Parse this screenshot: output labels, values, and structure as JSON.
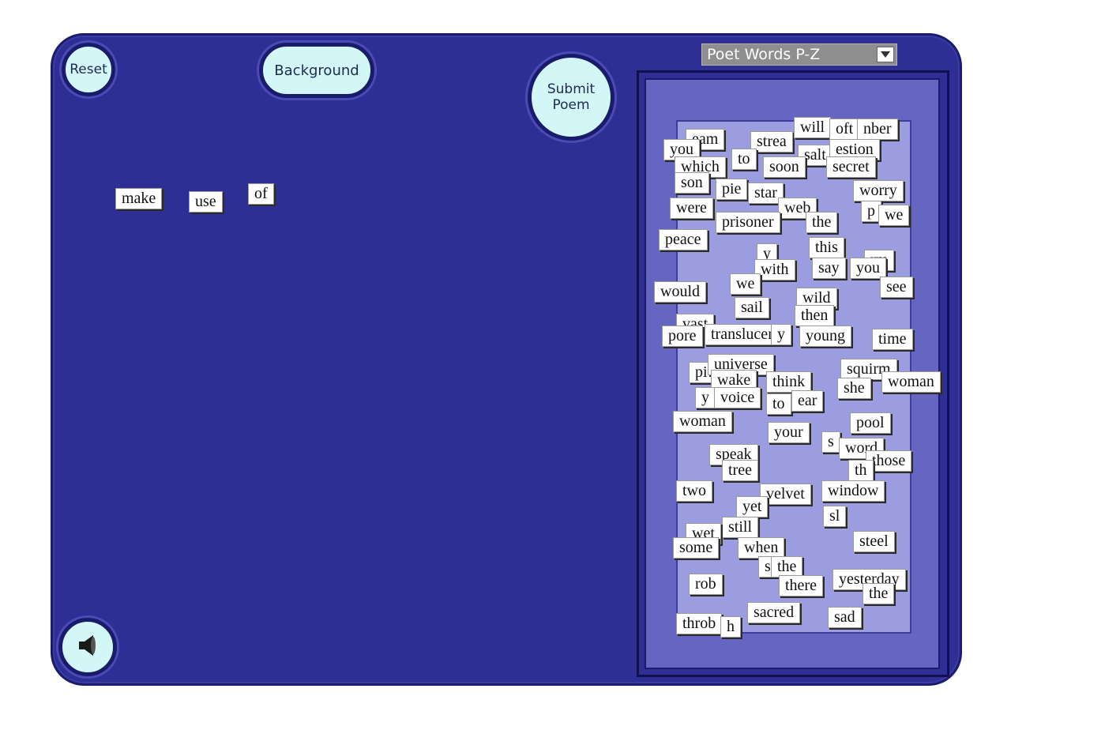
{
  "toolbar": {
    "reset_label": "Reset",
    "background_label": "Background",
    "submit_label": "Submit\nPoem",
    "speaker_icon": "speaker-icon"
  },
  "word_set_select": {
    "selected": "Poet Words P-Z",
    "arrow_icon": "chevron-down-icon"
  },
  "colors": {
    "board": "#2e2e94",
    "drawer_floor": "#9c9ce0",
    "button_fill": "#d3f7f7",
    "tile": "#ffffff"
  },
  "poem_words": [
    "make",
    "use",
    "of"
  ],
  "drawer_words": [
    "eam",
    "strea",
    "will",
    "oft",
    "nber",
    "you",
    "to",
    "salt",
    "estion",
    "which",
    "soon",
    "secret",
    "son",
    "pie",
    "star",
    "worry",
    "were",
    "web",
    "p",
    "we",
    "prisoner",
    "the",
    "peace",
    "this",
    "y",
    "rm",
    "say",
    "you",
    "with",
    "would",
    "we",
    "see",
    "sail",
    "wild",
    "then",
    "vast",
    "pore",
    "translucent",
    "y",
    "young",
    "time",
    "pi",
    "universe",
    "squirm",
    "woman",
    "she",
    "wake",
    "think",
    "y",
    "voice",
    "to",
    "ear",
    "woman",
    "pool",
    "your",
    "s",
    "word",
    "those",
    "speak",
    "th",
    "tree",
    "two",
    "velvet",
    "window",
    "yet",
    "still",
    "sl",
    "wet",
    "steel",
    "some",
    "when",
    "s",
    "the",
    "rob",
    "there",
    "yesterday",
    "the",
    "sacred",
    "sad",
    "throb",
    "h"
  ]
}
